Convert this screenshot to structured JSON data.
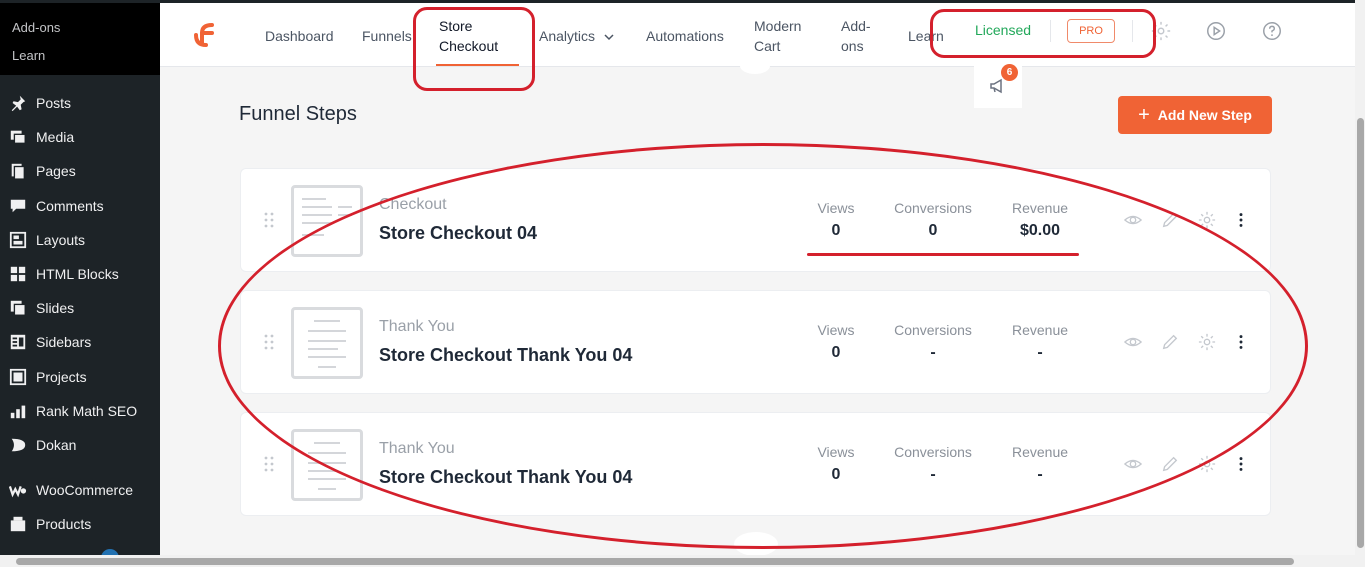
{
  "wp_sidebar": {
    "submenu": [
      {
        "label": "Add-ons"
      },
      {
        "label": "Learn"
      }
    ],
    "menu": [
      {
        "label": "Posts",
        "icon": "pin-icon"
      },
      {
        "label": "Media",
        "icon": "media-icon"
      },
      {
        "label": "Pages",
        "icon": "pages-icon"
      },
      {
        "label": "Comments",
        "icon": "comments-icon"
      },
      {
        "label": "Layouts",
        "icon": "layouts-icon"
      },
      {
        "label": "HTML Blocks",
        "icon": "blocks-icon"
      },
      {
        "label": "Slides",
        "icon": "slides-icon"
      },
      {
        "label": "Sidebars",
        "icon": "sidebars-icon"
      },
      {
        "label": "Projects",
        "icon": "projects-icon"
      },
      {
        "label": "Rank Math SEO",
        "icon": "rankmath-icon"
      },
      {
        "label": "Dokan",
        "icon": "dokan-icon"
      },
      {
        "label": "WooCommerce",
        "icon": "woocommerce-icon"
      },
      {
        "label": "Products",
        "icon": "products-icon"
      }
    ]
  },
  "topnav": {
    "items": [
      {
        "label": "Dashboard"
      },
      {
        "label": "Funnels"
      },
      {
        "label": "Store Checkout",
        "active": true
      },
      {
        "label": "Analytics"
      },
      {
        "label": "Automations"
      },
      {
        "label": "Modern Cart"
      },
      {
        "label": "Add-ons"
      },
      {
        "label": "Learn"
      }
    ],
    "licensed": "Licensed",
    "pro": "PRO",
    "notifications_count": "6"
  },
  "page": {
    "title": "Funnel Steps",
    "add_button": "Add New Step"
  },
  "stat_labels": {
    "views": "Views",
    "conversions": "Conversions",
    "revenue": "Revenue"
  },
  "steps": [
    {
      "type": "Checkout",
      "name": "Store Checkout 04",
      "views": "0",
      "conversions": "0",
      "revenue": "$0.00"
    },
    {
      "type": "Thank You",
      "name": "Store Checkout Thank You 04",
      "views": "0",
      "conversions": "-",
      "revenue": "-"
    },
    {
      "type": "Thank You",
      "name": "Store Checkout Thank You 04",
      "views": "0",
      "conversions": "-",
      "revenue": "-"
    }
  ],
  "colors": {
    "accent": "#f06335",
    "licensed": "#22a85a",
    "annotation": "#d4202c",
    "wp_sidebar": "#1d2327"
  }
}
